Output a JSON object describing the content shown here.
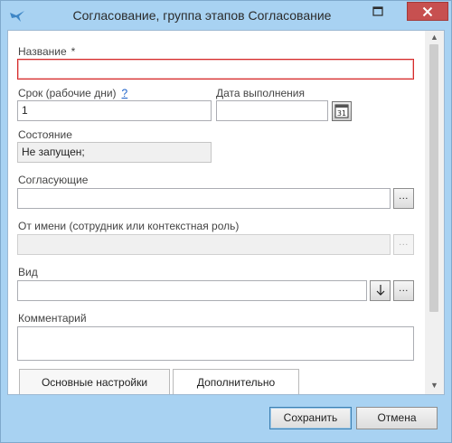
{
  "window": {
    "title": "Согласование, группа этапов Согласование",
    "icon": "app-bird-icon",
    "controls": [
      "maximize-icon",
      "close-icon"
    ]
  },
  "form": {
    "name": {
      "label": "Название",
      "required_mark": "*",
      "value": ""
    },
    "term": {
      "label": "Срок (рабочие дни)",
      "help": "?",
      "value": "1"
    },
    "due_date": {
      "label": "Дата выполнения",
      "value": "",
      "calendar_icon": "calendar-icon",
      "calendar_day": "31"
    },
    "state": {
      "label": "Состояние",
      "value": "Не запущен;"
    },
    "approvers": {
      "label": "Согласующие",
      "value": "",
      "browse": "..."
    },
    "on_behalf": {
      "label": "От имени (сотрудник или контекстная роль)",
      "value": "",
      "browse": "..."
    },
    "kind": {
      "label": "Вид",
      "value": "",
      "dropdown_icon": "arrow-down-icon",
      "browse": "..."
    },
    "comment": {
      "label": "Комментарий",
      "value": ""
    }
  },
  "tabs": [
    {
      "label": "Основные настройки",
      "active": true
    },
    {
      "label": "Дополнительно",
      "active": false
    }
  ],
  "scrollbar": {
    "up": "▲",
    "down": "▼"
  },
  "buttons": {
    "save": "Сохранить",
    "cancel": "Отмена"
  },
  "colors": {
    "titlebar": "#a8d2f2",
    "close": "#c75050",
    "error_border": "#d62b2b",
    "link": "#1a60c9"
  }
}
